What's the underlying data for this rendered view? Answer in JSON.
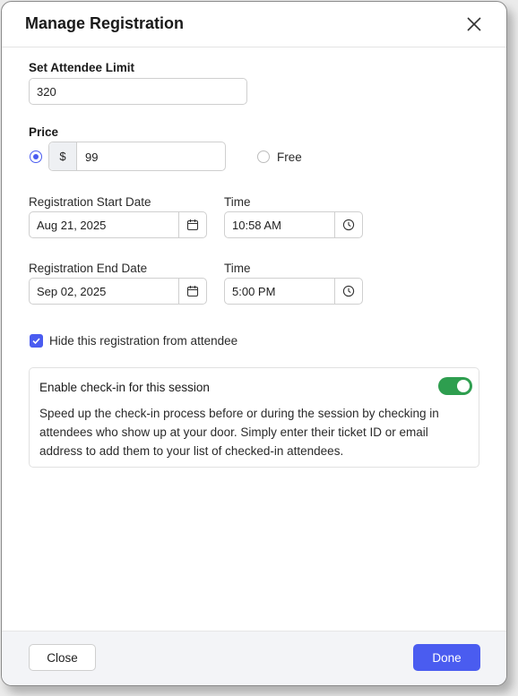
{
  "dialog": {
    "title": "Manage Registration"
  },
  "attendee_limit": {
    "label": "Set Attendee Limit",
    "value": "320"
  },
  "price": {
    "label": "Price",
    "currency_symbol": "$",
    "value": "99",
    "paid_selected": true,
    "free_label": "Free"
  },
  "start": {
    "date_label": "Registration Start Date",
    "date_value": "Aug 21, 2025",
    "time_label": "Time",
    "time_value": "10:58 AM"
  },
  "end": {
    "date_label": "Registration End Date",
    "date_value": "Sep 02, 2025",
    "time_label": "Time",
    "time_value": "5:00 PM"
  },
  "hide_registration": {
    "label": "Hide this registration from attendee",
    "checked": true
  },
  "checkin": {
    "title": "Enable check-in for this session",
    "description": "Speed up the check-in process before or during the session by checking in attendees who show up at your door. Simply enter their ticket ID or email address to add them to your list of checked-in attendees.",
    "enabled": true
  },
  "footer": {
    "close_label": "Close",
    "done_label": "Done"
  },
  "colors": {
    "accent": "#4a5cf0",
    "toggle_on": "#2e9e4f"
  }
}
